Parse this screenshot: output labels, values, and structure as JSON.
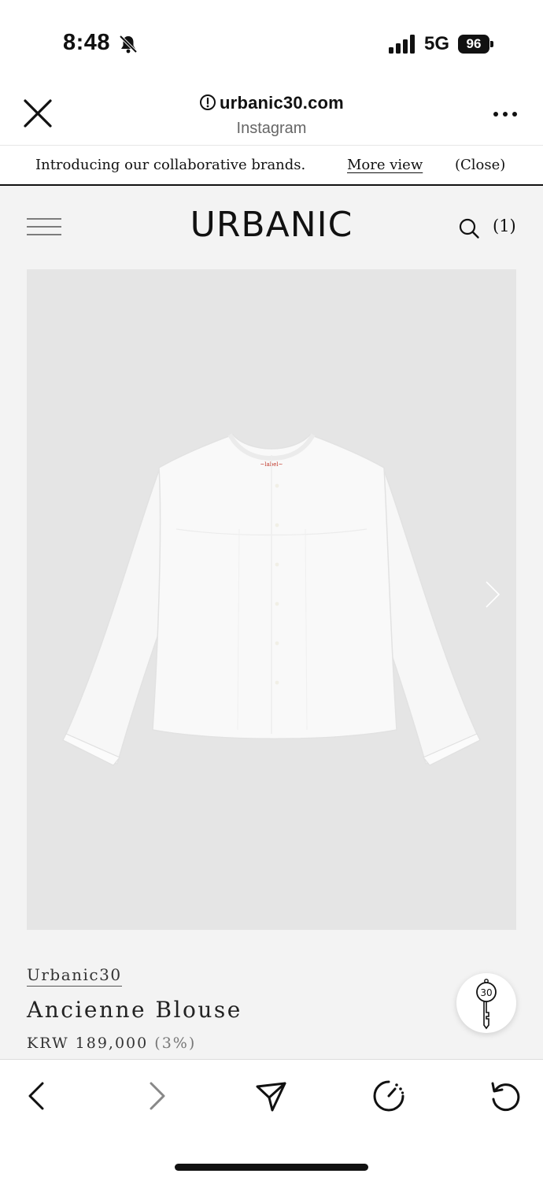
{
  "status_bar": {
    "time": "8:48",
    "network": "5G",
    "battery": "96",
    "icons": [
      "bell-slash-icon",
      "signal-icon",
      "battery-icon"
    ]
  },
  "browser": {
    "url": "urbanic30.com",
    "subtitle": "Instagram",
    "icons": [
      "close-icon",
      "info-icon",
      "more-icon"
    ]
  },
  "announcement": {
    "text": "Introducing our collaborative brands.",
    "link": "More view",
    "close": "(Close)"
  },
  "site_header": {
    "logo": "URBANIC",
    "cart_count": "(1)",
    "icons": [
      "hamburger-icon",
      "search-icon"
    ]
  },
  "product": {
    "brand": "Urbanic30",
    "title": "Ancienne Blouse",
    "price": "KRW 189,000",
    "discount": "(3%)",
    "image_icon": "next-arrow-icon",
    "badge_number": "30"
  },
  "toolbar": {
    "icons": [
      "back-icon",
      "forward-icon",
      "share-icon",
      "speed-icon",
      "refresh-icon"
    ]
  },
  "colors": {
    "site_background": "#f3f3f3",
    "image_background": "#e5e5e5",
    "text": "#111111",
    "badge_accent": "#c0392b"
  }
}
